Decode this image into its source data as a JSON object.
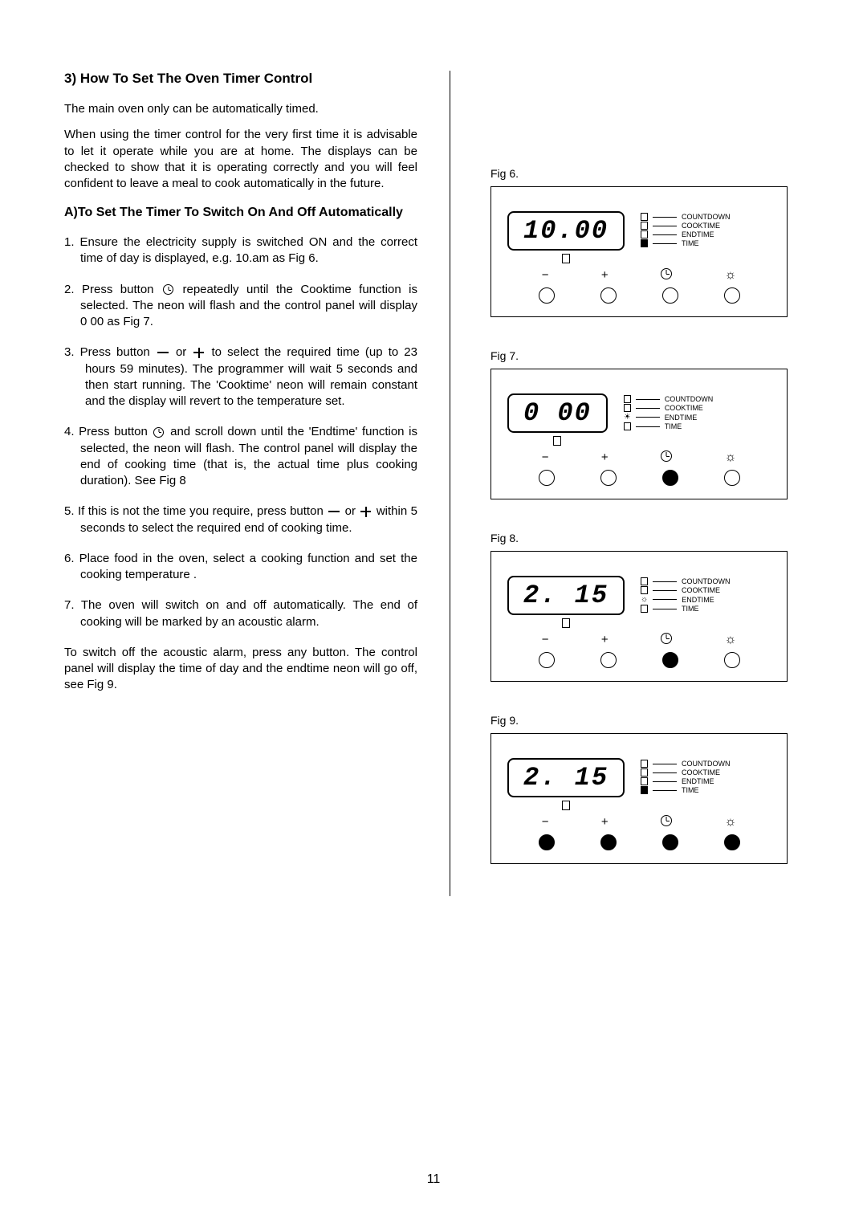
{
  "heading": "3) How To Set The Oven Timer Control",
  "intro1": "The main oven only can be automatically timed.",
  "intro2": "When using the timer control for the very first time it is advisable to let it operate while you are at home.  The displays can be checked to show that it is operating correctly and you will feel confident to leave a meal to cook automatically in the future.",
  "sectionA": "A)To Set The Timer To Switch On And Off Automatically",
  "step1": "1. Ensure the electricity supply is switched ON and the correct time of day is displayed, e.g. 10.am as Fig 6.",
  "step2a": "2. Press button ",
  "step2b": " repeatedly until the Cooktime function is selected.  The neon will flash and the control panel will display 0 00 as Fig 7.",
  "step3a": "3.  Press button ",
  "step3b": " or ",
  "step3c": " to select the required time (up to 23 hours 59 minutes). The programmer will wait 5 seconds and then start running. The 'Cooktime' neon will remain constant and the display will revert to the temperature set.",
  "step4a": "4. Press button  ",
  "step4b": "   and scroll down until the 'Endtime' function is selected, the neon will flash.  The control panel will display the end of cooking time (that is, the actual time plus cooking duration).  See Fig 8",
  "step5a": "5. If this is not the time you require, press button ",
  "step5b": " or ",
  "step5c": " within 5 seconds to select the required end of cooking time.",
  "step6": "6. Place food in the oven, select a cooking function and set the cooking temperature .",
  "step7": "7. The oven will switch on and off automatically.  The end of cooking will be marked by an acoustic alarm.",
  "outro": "To switch off the acoustic alarm, press any button.  The control panel will display the time of day and the endtime neon will go off,  see Fig 9.",
  "fig6": {
    "label": "Fig  6.",
    "display": "10.00",
    "indicators": [
      "COUNTDOWN",
      "COOKTIME",
      "ENDTIME",
      "TIME"
    ]
  },
  "fig7": {
    "label": "Fig  7.",
    "display": "0 00",
    "indicators": [
      "COUNTDOWN",
      "COOKTIME",
      "ENDTIME",
      "TIME"
    ]
  },
  "fig8": {
    "label": "Fig  8.",
    "display": "2. 15",
    "indicators": [
      "COUNTDOWN",
      "COOKTIME",
      "ENDTIME",
      "TIME"
    ]
  },
  "fig9": {
    "label": "Fig  9.",
    "display": "2. 15",
    "indicators": [
      "COUNTDOWN",
      "COOKTIME",
      "ENDTIME",
      "TIME"
    ]
  },
  "pageNumber": "11"
}
